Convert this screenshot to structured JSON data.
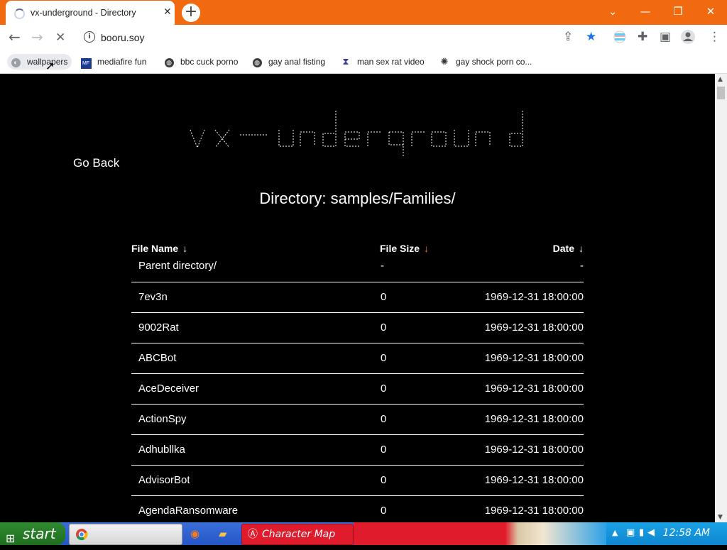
{
  "browser": {
    "tab_title": "vx-underground - Directory",
    "tab_close": "✕",
    "new_tab": "+",
    "url": "booru.soy",
    "window_controls": {
      "dropdown": "⌄",
      "minimize": "—",
      "restore": "❐",
      "close": "✕"
    }
  },
  "bookmarks": [
    {
      "label": "wallpapers",
      "icon": "site-icon"
    },
    {
      "label": "mediafire fun",
      "icon": "mediafire-icon"
    },
    {
      "label": "bbc cuck porno",
      "icon": "globe-icon"
    },
    {
      "label": "gay anal fisting",
      "icon": "globe-icon"
    },
    {
      "label": "man sex rat video",
      "icon": "bookmark-icon"
    },
    {
      "label": "gay shock porn co...",
      "icon": "spider-icon"
    }
  ],
  "page": {
    "go_back": "Go Back",
    "title": "Directory: samples/Families/",
    "columns": {
      "name": "File Name",
      "size": "File Size",
      "date": "Date",
      "sort_arrow": "↓"
    },
    "parent": {
      "name": "Parent directory/",
      "size": "-",
      "date": "-"
    },
    "rows": [
      {
        "name": "7ev3n",
        "size": "0",
        "date": "1969-12-31 18:00:00"
      },
      {
        "name": "9002Rat",
        "size": "0",
        "date": "1969-12-31 18:00:00"
      },
      {
        "name": "ABCBot",
        "size": "0",
        "date": "1969-12-31 18:00:00"
      },
      {
        "name": "AceDeceiver",
        "size": "0",
        "date": "1969-12-31 18:00:00"
      },
      {
        "name": "ActionSpy",
        "size": "0",
        "date": "1969-12-31 18:00:00"
      },
      {
        "name": "Adhubllka",
        "size": "0",
        "date": "1969-12-31 18:00:00"
      },
      {
        "name": "AdvisorBot",
        "size": "0",
        "date": "1969-12-31 18:00:00"
      },
      {
        "name": "AgendaRansomware",
        "size": "0",
        "date": "1969-12-31 18:00:00"
      }
    ]
  },
  "taskbar": {
    "start": "start",
    "active_window": "Character Map",
    "clock": "12:58 AM"
  },
  "colors": {
    "tabstrip": "#f26a10",
    "page_bg": "#000000",
    "taskbar": "#2456c8",
    "active_task": "#e01c2c"
  }
}
